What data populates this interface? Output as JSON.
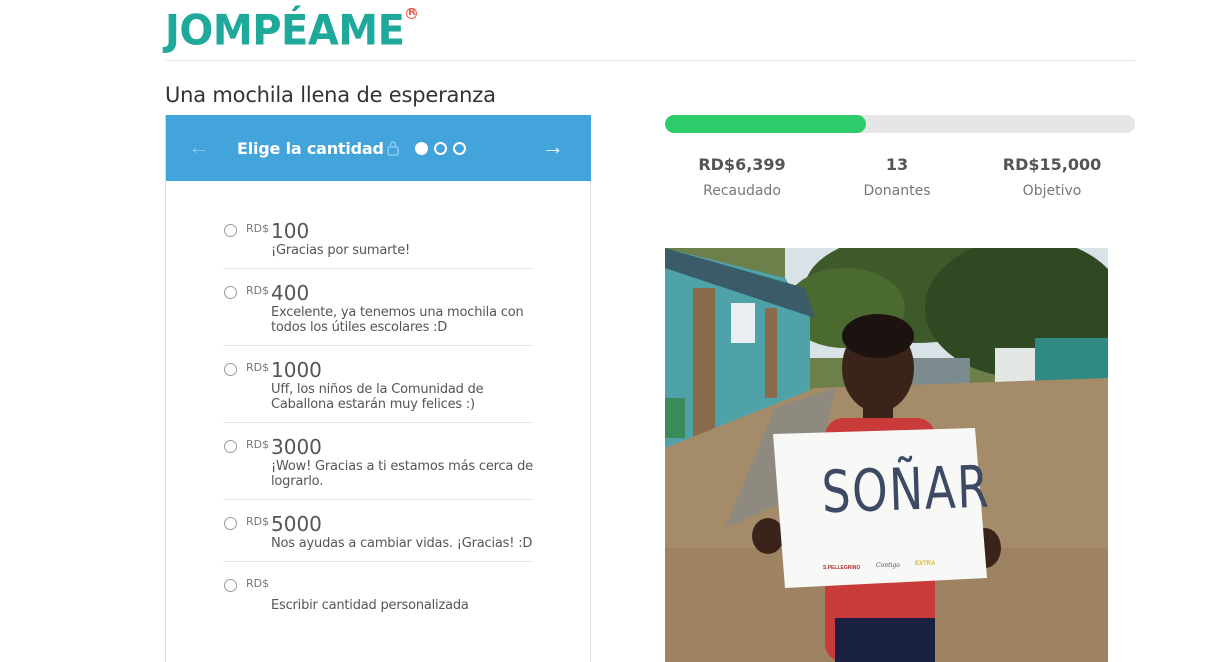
{
  "brand": {
    "logo_text": "JOMPÉAME",
    "reg_mark": "R"
  },
  "page": {
    "title": "Una mochila llena de esperanza"
  },
  "donation_panel": {
    "title": "Elige la cantidad",
    "step_current": 1,
    "step_total": 3,
    "options": [
      {
        "currency": "RD$",
        "amount": "100",
        "description": "¡Gracias por sumarte!"
      },
      {
        "currency": "RD$",
        "amount": "400",
        "description": "Excelente, ya tenemos una mochila con todos los útiles escolares :D"
      },
      {
        "currency": "RD$",
        "amount": "1000",
        "description": "Uff, los niños de la Comunidad de Caballona estarán muy felices :)"
      },
      {
        "currency": "RD$",
        "amount": "3000",
        "description": "¡Wow! Gracias a ti estamos más cerca de lograrlo."
      },
      {
        "currency": "RD$",
        "amount": "5000",
        "description": "Nos ayudas a cambiar vidas. ¡Gracias! :D"
      },
      {
        "currency": "RD$",
        "amount": "",
        "description": "Escribir cantidad personalizada"
      }
    ]
  },
  "campaign": {
    "progress_fraction": 0.4266,
    "raised_value": "RD$6,399",
    "raised_label": "Recaudado",
    "donors_value": "13",
    "donors_label": "Donantes",
    "goal_value": "RD$15,000",
    "goal_label": "Objetivo"
  },
  "photo": {
    "sign_text": "SOÑAR",
    "sponsor_1": "S.PELLEGRINO",
    "sponsor_2": "Contigo",
    "sponsor_3": "EXTRA"
  },
  "colors": {
    "brand": "#1fa99a",
    "header": "#43a3db",
    "progress": "#2ecc6a",
    "accent": "#e8604c"
  }
}
